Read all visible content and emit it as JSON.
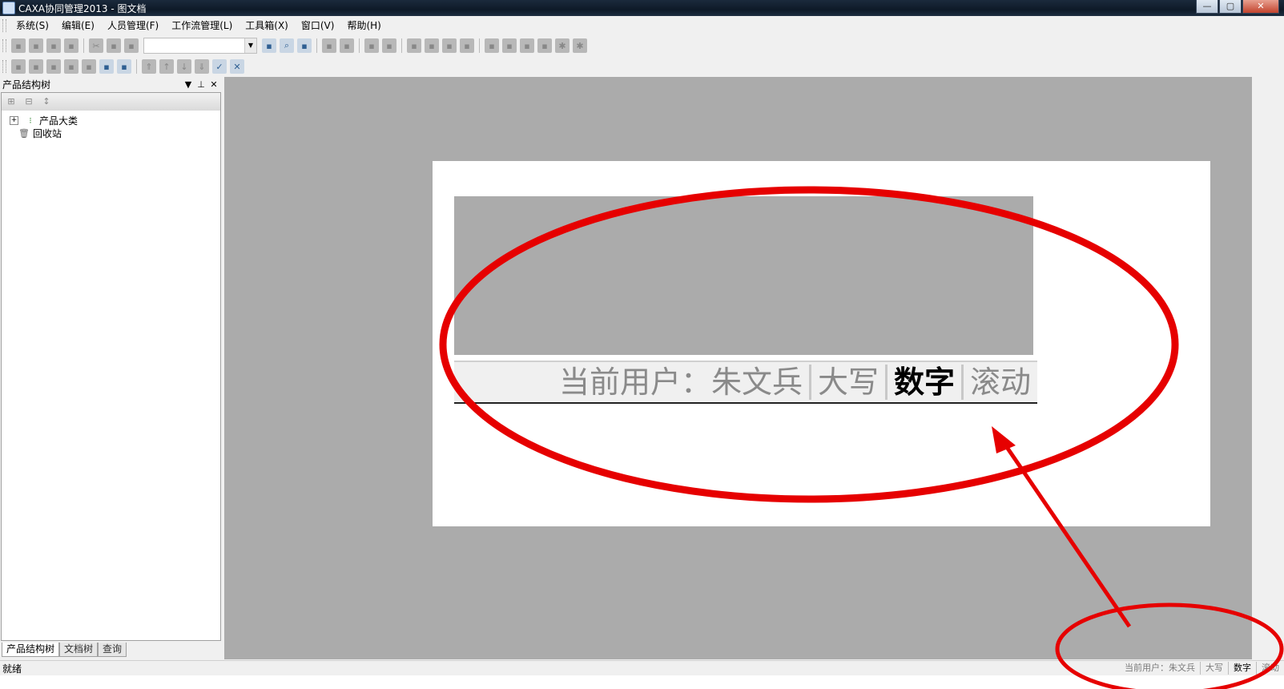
{
  "window": {
    "title": "CAXA协同管理2013 - 图文档",
    "controls": {
      "minimize": "—",
      "maximize": "▢",
      "close": "✕"
    }
  },
  "menubar": {
    "items": [
      "系统(S)",
      "编辑(E)",
      "人员管理(F)",
      "工作流管理(L)",
      "工具箱(X)",
      "窗口(V)",
      "帮助(H)"
    ]
  },
  "toolbar1": {
    "combo_value": ""
  },
  "panel": {
    "title": "产品结构树",
    "tree": [
      {
        "label": "产品大类",
        "icon": "product-category-icon",
        "expander": "+"
      },
      {
        "label": "回收站",
        "icon": "recycle-bin-icon"
      }
    ],
    "tabs": [
      "产品结构树",
      "文档树",
      "查询"
    ]
  },
  "zoom": {
    "status": {
      "current_user": "当前用户：朱文兵",
      "caps": "大写",
      "num": "数字",
      "scroll": "滚动"
    }
  },
  "statusbar": {
    "ready": "就绪",
    "current_user": "当前用户：朱文兵",
    "caps": "大写",
    "num": "数字",
    "scroll": "滚动"
  },
  "annotation_color": "#e60000"
}
